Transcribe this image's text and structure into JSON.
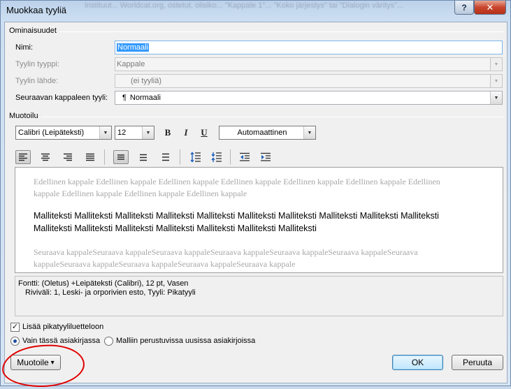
{
  "window": {
    "title": "Muokkaa tyyliä",
    "background_blur_text": "Instituut... Worldcat.org, ostetut, olisiko... \"Kappale 1\"... \"Koko järjestys\" tai \"Dialogin väritys\"...",
    "help_glyph": "?",
    "close_glyph": "✕"
  },
  "properties": {
    "group_label": "Ominaisuudet",
    "name_label": "Nimi:",
    "name_value": "Normaali",
    "style_type_label": "Tyylin tyyppi:",
    "style_type_value": "Kappale",
    "based_on_label": "Tyylin lähde:",
    "based_on_value": "(ei tyyliä)",
    "next_style_label": "Seuraavan kappaleen tyyli:",
    "next_style_value": "Normaali",
    "next_style_icon": "¶"
  },
  "formatting": {
    "group_label": "Muotoilu",
    "font_name": "Calibri (Leipäteksti)",
    "font_size": "12",
    "bold_glyph": "B",
    "italic_glyph": "I",
    "underline_glyph": "U",
    "color_value": "Automaattinen",
    "arrow_glyph": "▼"
  },
  "preview": {
    "previous_text": "Edellinen kappale Edellinen kappale Edellinen kappale Edellinen kappale Edellinen kappale Edellinen kappale Edellinen kappale Edellinen kappale Edellinen kappale Edellinen kappale",
    "sample_text": "Malliteksti Malliteksti Malliteksti Malliteksti Malliteksti Malliteksti Malliteksti Malliteksti Malliteksti Malliteksti Malliteksti Malliteksti Malliteksti Malliteksti Malliteksti Malliteksti Malliteksti",
    "next_text": "Seuraava kappaleSeuraava kappaleSeuraava kappaleSeuraava kappaleSeuraava kappaleSeuraava kappaleSeuraava kappaleSeuraava kappaleSeuraava kappaleSeuraava kappaleSeuraava kappale"
  },
  "description": {
    "line1": "Fontti: (Oletus) +Leipäteksti (Calibri), 12 pt, Vasen",
    "line2": "Riviväli:  1, Leski- ja orporivien esto, Tyyli: Pikatyyli"
  },
  "options": {
    "add_quick_style_label": "Lisää pikatyyliluetteloon",
    "add_quick_style_checked": true,
    "check_glyph": "✓",
    "only_this_doc_label": "Vain tässä asiakirjassa",
    "new_docs_label": "Malliin perustuvissa uusissa asiakirjoissa"
  },
  "buttons": {
    "format_label": "Muotoile",
    "format_arrow": "▾",
    "ok_label": "OK",
    "cancel_label": "Peruuta"
  },
  "colors": {
    "annotation_red": "#e00000",
    "selection_blue": "#3399ff"
  }
}
